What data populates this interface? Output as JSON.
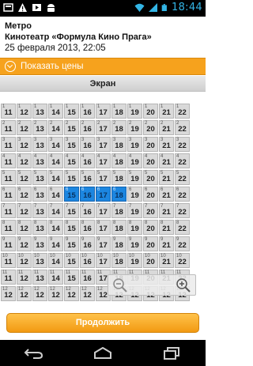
{
  "status_bar": {
    "time": "18:44",
    "left_icons": [
      "notification-icon",
      "warning-icon",
      "media-icon",
      "android-icon"
    ],
    "right_icons": [
      "wifi-icon",
      "signal-icon",
      "battery-icon"
    ]
  },
  "header": {
    "line1": "Метро",
    "line2": "Кинотеатр «Формула Кино Прага»",
    "line3": "25 февраля 2013, 22:05"
  },
  "price_toggle": {
    "label": "Показать цены",
    "icon": "chevron-down-circle-icon"
  },
  "screen": {
    "label": "Экран"
  },
  "seating": {
    "rows": [
      {
        "row": "1",
        "seats": [
          "11",
          "12",
          "13",
          "14",
          "15",
          "16",
          "17",
          "18",
          "19",
          "20",
          "21",
          "22"
        ]
      },
      {
        "row": "2",
        "seats": [
          "11",
          "12",
          "13",
          "14",
          "15",
          "16",
          "17",
          "18",
          "19",
          "20",
          "21",
          "22"
        ]
      },
      {
        "row": "3",
        "seats": [
          "11",
          "12",
          "13",
          "14",
          "15",
          "16",
          "17",
          "18",
          "19",
          "20",
          "21",
          "22"
        ]
      },
      {
        "row": "4",
        "seats": [
          "11",
          "12",
          "13",
          "14",
          "15",
          "16",
          "17",
          "18",
          "19",
          "20",
          "21",
          "22"
        ]
      },
      {
        "row": "5",
        "seats": [
          "11",
          "12",
          "13",
          "14",
          "15",
          "16",
          "17",
          "18",
          "19",
          "20",
          "21",
          "22"
        ]
      },
      {
        "row": "6",
        "seats": [
          "11",
          "12",
          "13",
          "14",
          "15",
          "16",
          "17",
          "18",
          "19",
          "20",
          "21",
          "22"
        ]
      },
      {
        "row": "7",
        "seats": [
          "11",
          "12",
          "13",
          "14",
          "15",
          "16",
          "17",
          "18",
          "19",
          "20",
          "21",
          "22"
        ]
      },
      {
        "row": "8",
        "seats": [
          "11",
          "12",
          "13",
          "14",
          "15",
          "16",
          "17",
          "18",
          "19",
          "20",
          "21",
          "22"
        ]
      },
      {
        "row": "9",
        "seats": [
          "11",
          "12",
          "13",
          "14",
          "15",
          "16",
          "17",
          "18",
          "19",
          "20",
          "21",
          "22"
        ]
      },
      {
        "row": "10",
        "seats": [
          "11",
          "12",
          "13",
          "14",
          "15",
          "16",
          "17",
          "18",
          "19",
          "20",
          "21",
          "22"
        ]
      },
      {
        "row": "11",
        "seats": [
          "11",
          "12",
          "13",
          "14",
          "15",
          "16",
          "17",
          "18",
          "19",
          "20",
          "21",
          "22"
        ]
      },
      {
        "row": "12",
        "seats": [
          "12",
          "12",
          "12",
          "12",
          "12",
          "12",
          "12",
          "12",
          "12",
          "12",
          "12",
          "12"
        ]
      }
    ],
    "selected": [
      {
        "row": "6",
        "seats": [
          "15",
          "16",
          "17",
          "18"
        ]
      }
    ],
    "colors": {
      "seat": "#d9d9d9",
      "selected": "#1c86e0"
    }
  },
  "zoom": {
    "out_icon": "zoom-out-icon",
    "in_icon": "zoom-in-icon"
  },
  "actions": {
    "continue_label": "Продолжить"
  },
  "nav": {
    "icons": [
      "back-icon",
      "home-icon",
      "recent-apps-icon"
    ]
  },
  "colors": {
    "accent": "#f6a21d",
    "clock": "#33b5e5"
  }
}
